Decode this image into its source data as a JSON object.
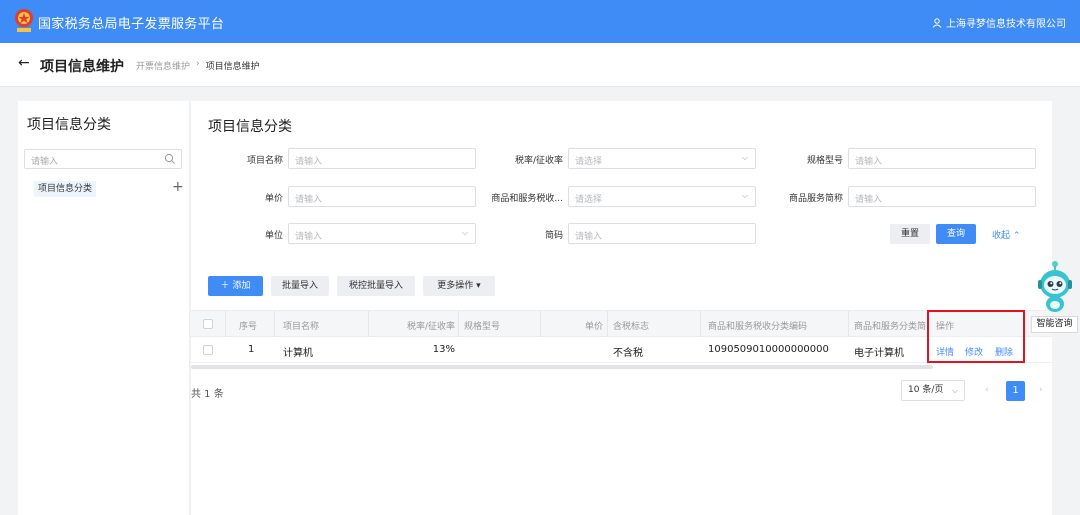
{
  "header": {
    "app_title": "国家税务总局电子发票服务平台",
    "company": "上海寻梦信息技术有限公司"
  },
  "breadcrumb": {
    "page_title": "项目信息维护",
    "parent": "开票信息维护",
    "separator": "›",
    "current": "项目信息维护"
  },
  "sidebar": {
    "title": "项目信息分类",
    "search_placeholder": "请输入",
    "category_label": "项目信息分类"
  },
  "main": {
    "title": "项目信息分类",
    "filters": {
      "name_label": "项目名称",
      "name_placeholder": "请输入",
      "rate_label": "税率/征收率",
      "rate_placeholder": "请选择",
      "spec_label": "规格型号",
      "spec_placeholder": "请输入",
      "price_label": "单价",
      "price_placeholder": "请输入",
      "taxcode_label": "商品和服务税收...",
      "taxcode_placeholder": "请选择",
      "short_label": "商品服务简称",
      "short_placeholder": "请输入",
      "unit_label": "单位",
      "unit_placeholder": "请输入",
      "brief_label": "简码",
      "brief_placeholder": "请输入"
    },
    "buttons": {
      "reset": "重置",
      "query": "查询",
      "collapse": "收起",
      "add": "添加",
      "batch_import": "批量导入",
      "tax_batch_import": "税控批量导入",
      "more_actions": "更多操作"
    },
    "table": {
      "headers": {
        "seq": "序号",
        "name": "项目名称",
        "rate": "税率/征收率",
        "spec": "规格型号",
        "price": "单价",
        "tax_flag": "含税标志",
        "tax_code": "商品和服务税收分类编码",
        "tax_short": "商品和服务分类简",
        "actions": "操作"
      },
      "rows": [
        {
          "seq": "1",
          "name": "计算机",
          "rate": "13%",
          "spec": "",
          "price": "",
          "tax_flag": "不含税",
          "tax_code": "1090509010000000000",
          "tax_short": "电子计算机",
          "detail": "详情",
          "edit": "修改",
          "delete": "删除"
        }
      ]
    },
    "pagination": {
      "total": "共 1 条",
      "page_size": "10 条/页",
      "current_page": "1"
    }
  },
  "assistant": {
    "label": "智能咨询"
  },
  "colors": {
    "brand_blue": "#3f8cf7",
    "highlight_red": "#e0141e"
  }
}
